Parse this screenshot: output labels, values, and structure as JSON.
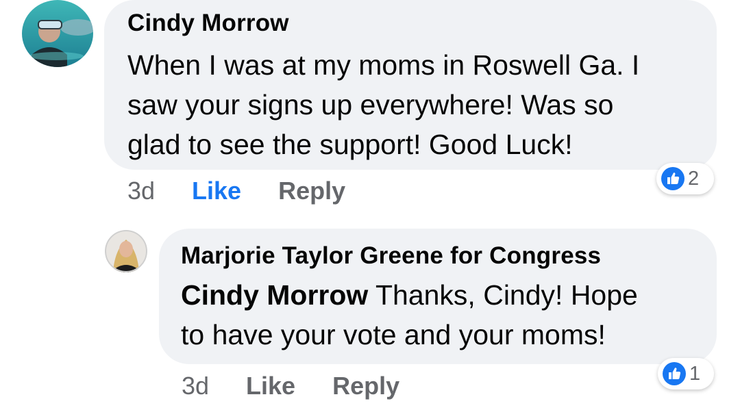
{
  "comment": {
    "author": "Cindy Morrow",
    "avatar_icon": "snorkeler-avatar-icon",
    "text_lines": [
      "When I was at my moms in Roswell Ga. I",
      "saw your signs up everywhere! Was so",
      "glad to see the support! Good Luck!"
    ],
    "time": "3d",
    "like_label": "Like",
    "reply_label": "Reply",
    "reaction_icon": "thumbs-up-icon",
    "reaction_count": "2",
    "liked": true
  },
  "reply": {
    "author": "Marjorie Taylor Greene for Congress",
    "avatar_icon": "profile-photo-avatar-icon",
    "mention": "Cindy Morrow",
    "text_line1": " Thanks, Cindy! Hope",
    "text_line2": "to have your vote and your moms!",
    "time": "3d",
    "like_label": "Like",
    "reply_label": "Reply",
    "reaction_icon": "thumbs-up-icon",
    "reaction_count": "1",
    "liked": false
  },
  "colors": {
    "bubble_bg": "#f0f2f5",
    "like_active": "#1877f2",
    "meta_gray": "#65676b",
    "text": "#050505"
  }
}
